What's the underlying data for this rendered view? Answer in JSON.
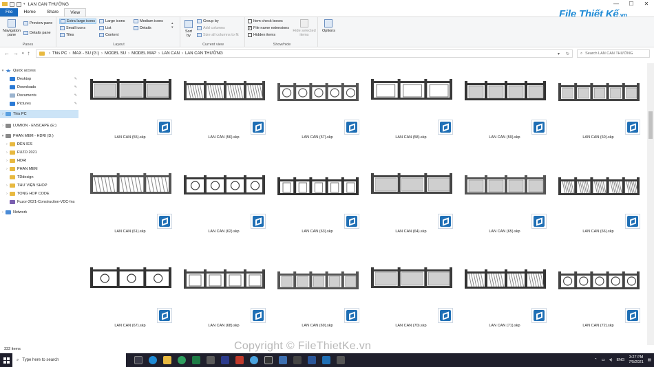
{
  "window": {
    "title": "LAN CAN THƯỜNG",
    "controls": [
      "—",
      "☐",
      "✕"
    ]
  },
  "tabs": [
    {
      "label": "File"
    },
    {
      "label": "Home"
    },
    {
      "label": "Share"
    },
    {
      "label": "View"
    }
  ],
  "ribbon": {
    "panes": {
      "label": "Panes",
      "navigation_pane": "Navigation pane",
      "preview_pane": "Preview pane",
      "details_pane": "Details pane"
    },
    "layout": {
      "label": "Layout",
      "extra_large_icons": "Extra large icons",
      "large_icons": "Large icons",
      "medium_icons": "Medium icons",
      "small_icons": "Small icons",
      "list": "List",
      "details": "Details",
      "tiles": "Tiles",
      "content": "Content"
    },
    "current_view": {
      "label": "Current view",
      "sort_by": "Sort by",
      "group_by": "Group by",
      "add_columns": "Add columns",
      "size_all_columns": "Size all columns to fit"
    },
    "show_hide": {
      "label": "Show/hide",
      "item_check_boxes": "Item check boxes",
      "file_name_extensions": "File name extensions",
      "hidden_items": "Hidden items",
      "hide_selected": "Hide selected items",
      "options": "Options"
    }
  },
  "address": {
    "segments": [
      "This PC",
      "MAX - SU (G:)",
      "MODEL SU",
      "MODEL MAP",
      "LAN CAN",
      "LAN CAN THƯỜNG"
    ],
    "search_placeholder": "Search LAN CAN THƯỜNG"
  },
  "sidebar": {
    "quick_access": "Quick access",
    "quick_items": [
      {
        "label": "Desktop"
      },
      {
        "label": "Downloads"
      },
      {
        "label": "Documents"
      },
      {
        "label": "Pictures"
      }
    ],
    "this_pc": "This PC",
    "drive_e": "LUMION - ENSCAPE (E:)",
    "drive_d": "PHAN MEM - HDRI (D:)",
    "folders": [
      {
        "label": "ĐÈN IES"
      },
      {
        "label": "FUZO 2021"
      },
      {
        "label": "HDRI"
      },
      {
        "label": "PHAN MEM"
      },
      {
        "label": "TDdesign"
      },
      {
        "label": "THƯ VIỆN SHOP"
      },
      {
        "label": "TONG HOP CODE"
      },
      {
        "label": "Fuzor-2021-Construction-VDC-Ins"
      }
    ],
    "network": "Network"
  },
  "files": [
    {
      "name": "LAN CAN (55).skp"
    },
    {
      "name": "LAN CAN (56).skp"
    },
    {
      "name": "LAN CAN (57).skp"
    },
    {
      "name": "LAN CAN (58).skp"
    },
    {
      "name": "LAN CAN (59).skp"
    },
    {
      "name": "LAN CAN (60).skp"
    },
    {
      "name": "LAN CAN (61).skp"
    },
    {
      "name": "LAN CAN (62).skp"
    },
    {
      "name": "LAN CAN (63).skp"
    },
    {
      "name": "LAN CAN (64).skp"
    },
    {
      "name": "LAN CAN (65).skp"
    },
    {
      "name": "LAN CAN (66).skp"
    },
    {
      "name": "LAN CAN (67).skp"
    },
    {
      "name": "LAN CAN (68).skp"
    },
    {
      "name": "LAN CAN (69).skp"
    },
    {
      "name": "LAN CAN (70).skp"
    },
    {
      "name": "LAN CAN (71).skp"
    },
    {
      "name": "LAN CAN (72).skp"
    }
  ],
  "status": {
    "item_count": "332 items"
  },
  "taskbar": {
    "search_placeholder": "Type here to search",
    "lang": "ENG",
    "time": "3:27 PM",
    "date": "7/5/2021"
  },
  "logo": {
    "text": "File Thiết Kế",
    "suffix": ".vn"
  },
  "watermark": "Copyright © FileThietKe.vn",
  "colors": {
    "accent": "#1a6bc0",
    "selection": "#cce4f7",
    "taskbar": "#1f1f2c",
    "sketchup": "#1f6fb5"
  }
}
